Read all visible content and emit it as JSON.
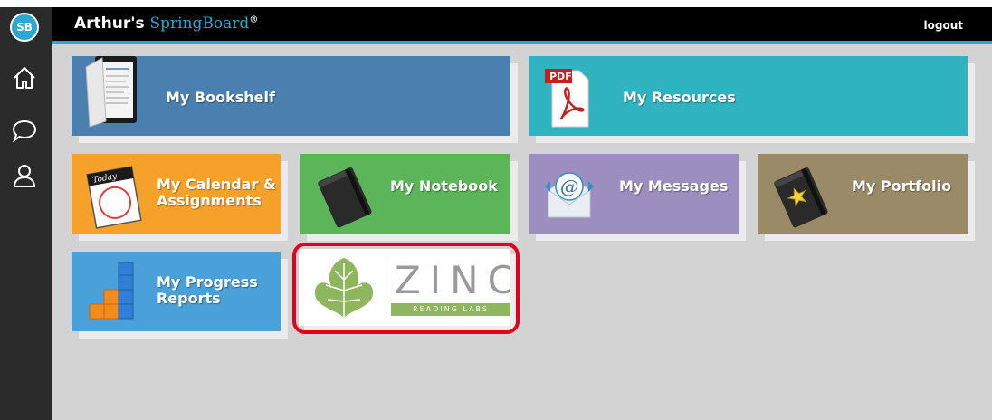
{
  "header": {
    "badge": "SB",
    "brand_owner": "Arthur's",
    "brand_name": "SpringBoard",
    "brand_mark": "®",
    "logout": "logout"
  },
  "sidebar": {
    "items": [
      {
        "icon": "home-icon"
      },
      {
        "icon": "chat-bubble-icon"
      },
      {
        "icon": "user-icon"
      }
    ]
  },
  "tiles": {
    "bookshelf": {
      "label": "My Bookshelf",
      "color": "#4a7fb0",
      "icon": "tablet-book-icon"
    },
    "resources": {
      "label": "My Resources",
      "color": "#2fb3c0",
      "icon": "pdf-icon"
    },
    "calendar": {
      "label1": "My Calendar &",
      "label2": "Assignments",
      "color": "#f5a12a",
      "icon": "calendar-today-icon"
    },
    "notebook": {
      "label": "My Notebook",
      "color": "#5db55a",
      "icon": "notebook-icon"
    },
    "messages": {
      "label": "My Messages",
      "color": "#9c8fbf",
      "icon": "email-at-icon"
    },
    "portfolio": {
      "label": "My Portfolio",
      "color": "#9a8a68",
      "icon": "portfolio-star-icon"
    },
    "progress": {
      "label1": "My Progress",
      "label2": "Reports",
      "color": "#4aa0d8",
      "icon": "bar-blocks-icon"
    },
    "zinc": {
      "word": "ZINC",
      "tagline": "READING LABS",
      "icon": "ivy-leaf-icon",
      "highlight": "#e3001b",
      "accent": "#8db65e"
    }
  }
}
